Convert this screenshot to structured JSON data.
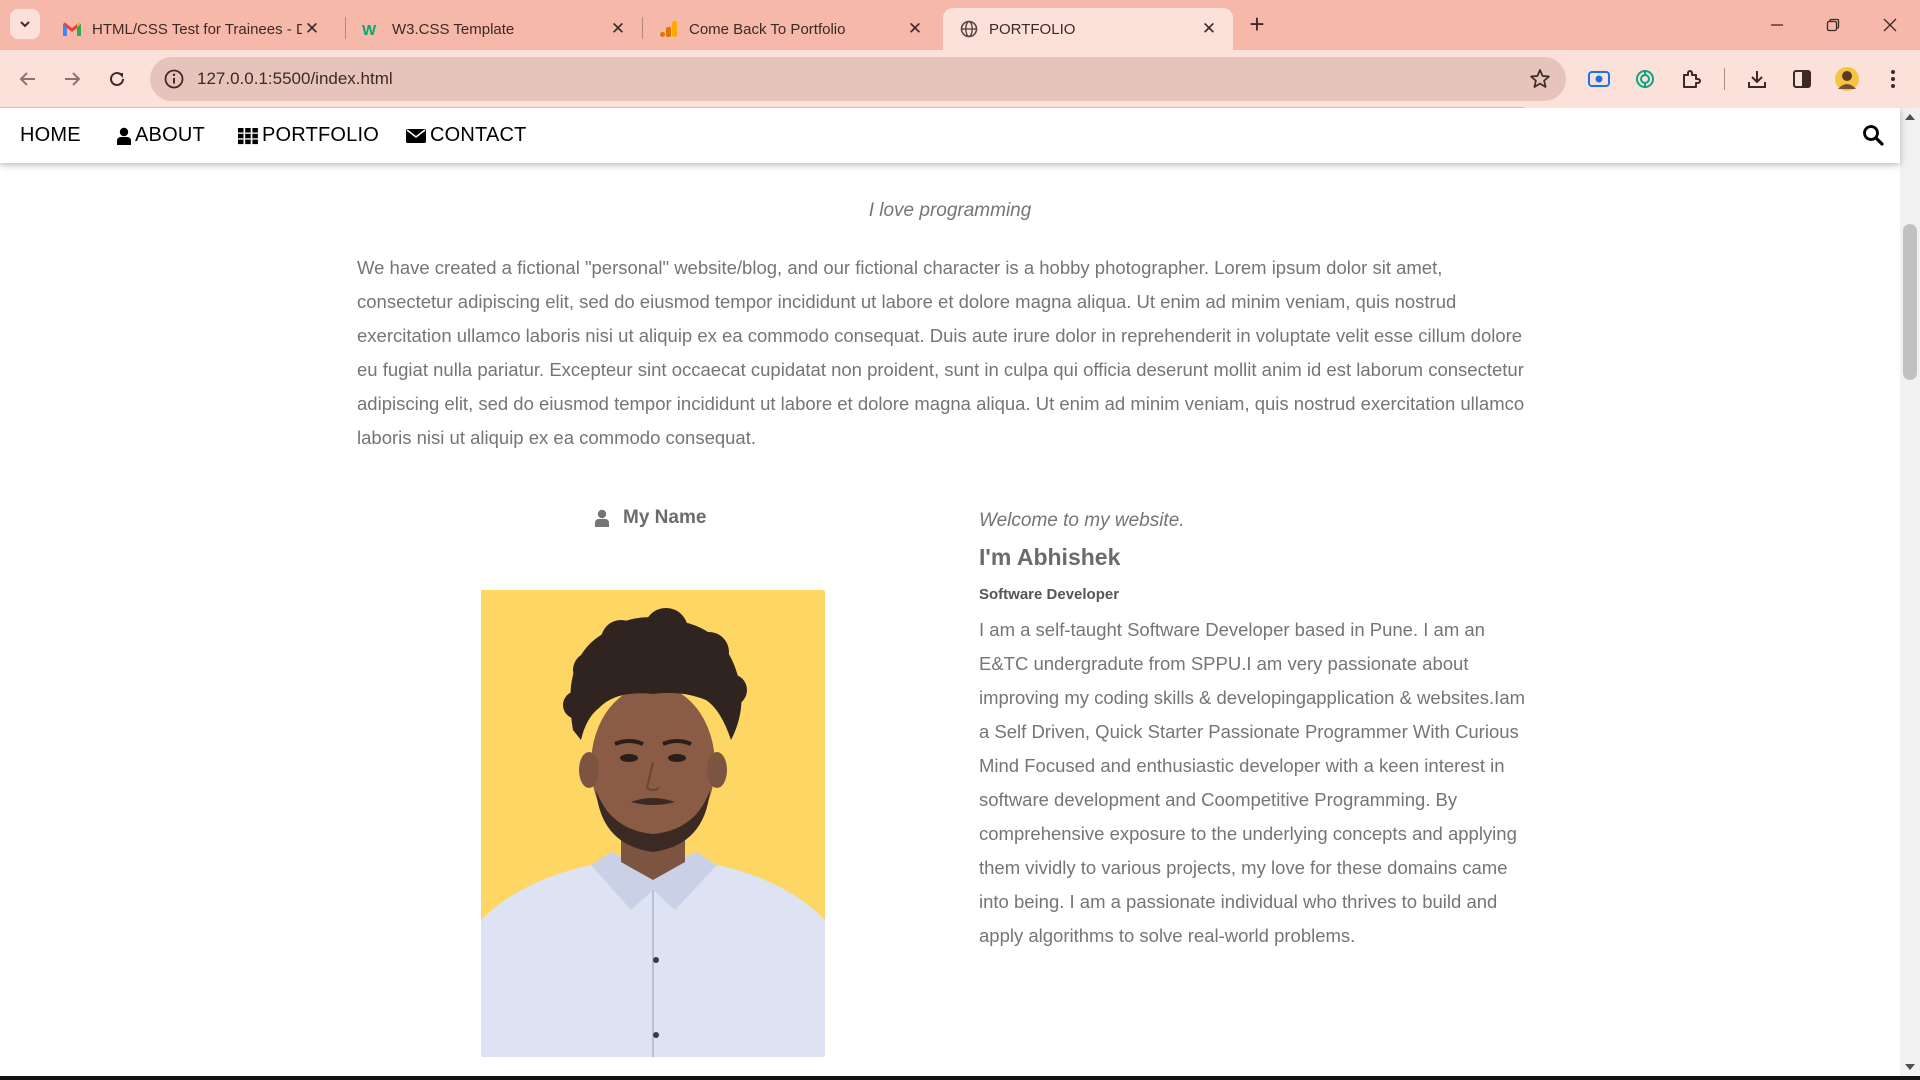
{
  "browser": {
    "tabs": [
      {
        "title": "HTML/CSS Test for Trainees - D",
        "icon": "gmail-icon",
        "active": false
      },
      {
        "title": "W3.CSS Template",
        "icon": "w3schools-icon",
        "active": false
      },
      {
        "title": "Come Back To Portfolio",
        "icon": "google-analytics-icon",
        "active": false
      },
      {
        "title": "PORTFOLIO",
        "icon": "globe-icon",
        "active": true
      }
    ],
    "close_glyph": "✕",
    "new_tab_glyph": "+",
    "url": "127.0.0.1:5500/index.html",
    "colors": {
      "tabbar": "#f6b8a8",
      "active_tab": "#fbe1d9",
      "omnibox": "#e7c4bb"
    }
  },
  "nav": {
    "home": "HOME",
    "about": "ABOUT",
    "portfolio": "PORTFOLIO",
    "contact": "CONTACT"
  },
  "page": {
    "tagline": "I love programming",
    "intro": "We have created a fictional \"personal\" website/blog, and our fictional character is a hobby photographer. Lorem ipsum dolor sit amet, consectetur adipiscing elit, sed do eiusmod tempor incididunt ut labore et dolore magna aliqua. Ut enim ad minim veniam, quis nostrud exercitation ullamco laboris nisi ut aliquip ex ea commodo consequat. Duis aute irure dolor in reprehenderit in voluptate velit esse cillum dolore eu fugiat nulla pariatur. Excepteur sint occaecat cupidatat non proident, sunt in culpa qui officia deserunt mollit anim id est laborum consectetur adipiscing elit, sed do eiusmod tempor incididunt ut labore et dolore magna aliqua. Ut enim ad minim veniam, quis nostrud exercitation ullamco laboris nisi ut aliquip ex ea commodo consequat.",
    "my_name": "My Name",
    "welcome": "Welcome to my website.",
    "greeting": "I'm Abhishek",
    "role": "Software Developer",
    "bio": "I am a self-taught Software Developer based in Pune. I am an E&TC undergradute from SPPU.I am very passionate about improving my coding skills & developingapplication & websites.Iam a Self Driven, Quick Starter Passionate Programmer With Curious Mind Focused and enthusiastic developer with a keen interest in software development and Coompetitive Programming. By comprehensive exposure to the underlying concepts and applying them vividly to various projects, my love for these domains came into being. I am a passionate individual who thrives to build and apply algorithms to solve real-world problems.",
    "photo_background": "#fdd664"
  }
}
